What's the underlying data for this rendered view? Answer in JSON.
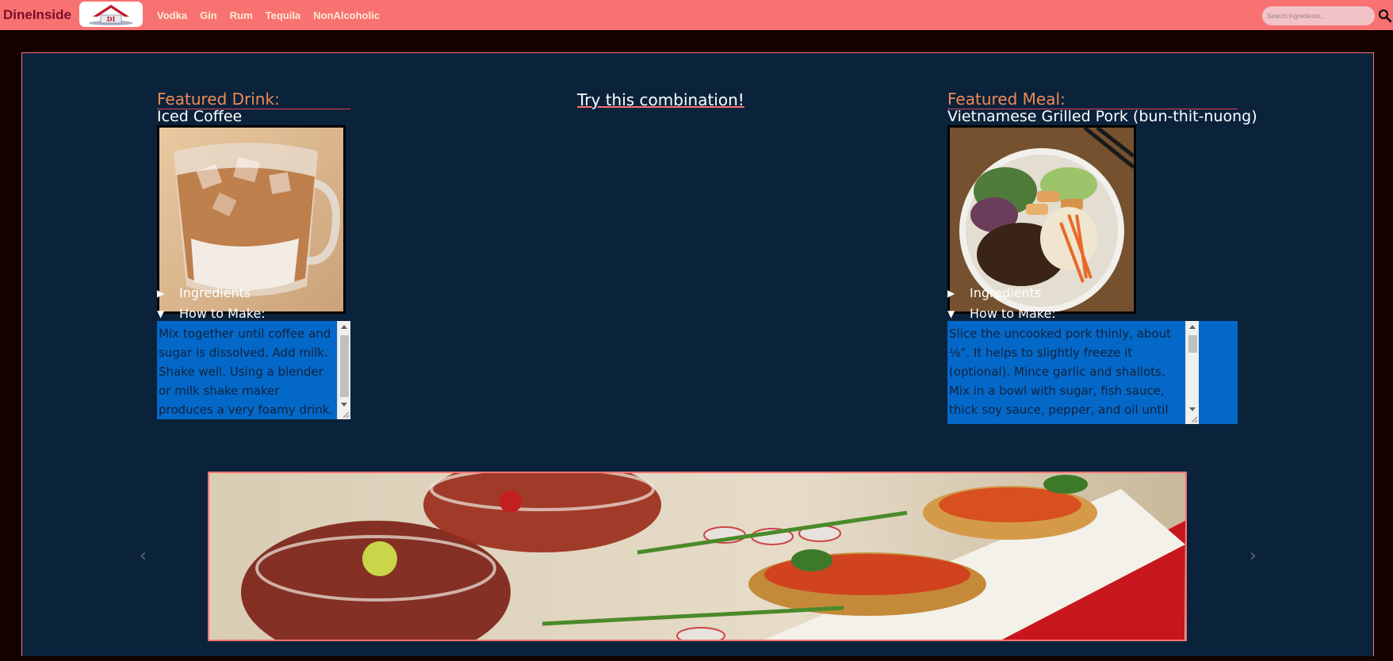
{
  "brand": "DineInside",
  "nav": [
    "Vodka",
    "Gin",
    "Rum",
    "Tequila",
    "NonAlcoholic"
  ],
  "search": {
    "placeholder": "Search Ingredients..."
  },
  "combo_title": "Try this combination!",
  "drink": {
    "section_label": "Featured Drink:",
    "name": "Iced Coffee",
    "ingredients_label": "Ingredients",
    "howto_label": "How to Make:",
    "instructions": "Mix together until coffee and sugar is dissolved. Add milk. Shake well. Using a blender or milk shake maker produces a very foamy drink. Serve in"
  },
  "meal": {
    "section_label": "Featured Meal:",
    "name": "Vietnamese Grilled Pork (bun-thit-nuong)",
    "ingredients_label": "Ingredients",
    "howto_label": "How to Make:",
    "instructions": "Slice the uncooked pork thinly, about ⅛\". It helps to slightly freeze it (optional). Mince garlic and shallots. Mix in a bowl with sugar, fish sauce, thick soy sauce, pepper, and oil until sugar dissolves."
  },
  "carousel": {
    "prev": "‹",
    "next": "›"
  },
  "colors": {
    "navbar": "#f87272",
    "panel": "#0b223b",
    "accent": "#f08a55",
    "textbox": "#0468c9"
  },
  "icons": [
    "search-icon",
    "house-logo-icon",
    "collapsed-triangle-icon",
    "expanded-triangle-icon"
  ]
}
